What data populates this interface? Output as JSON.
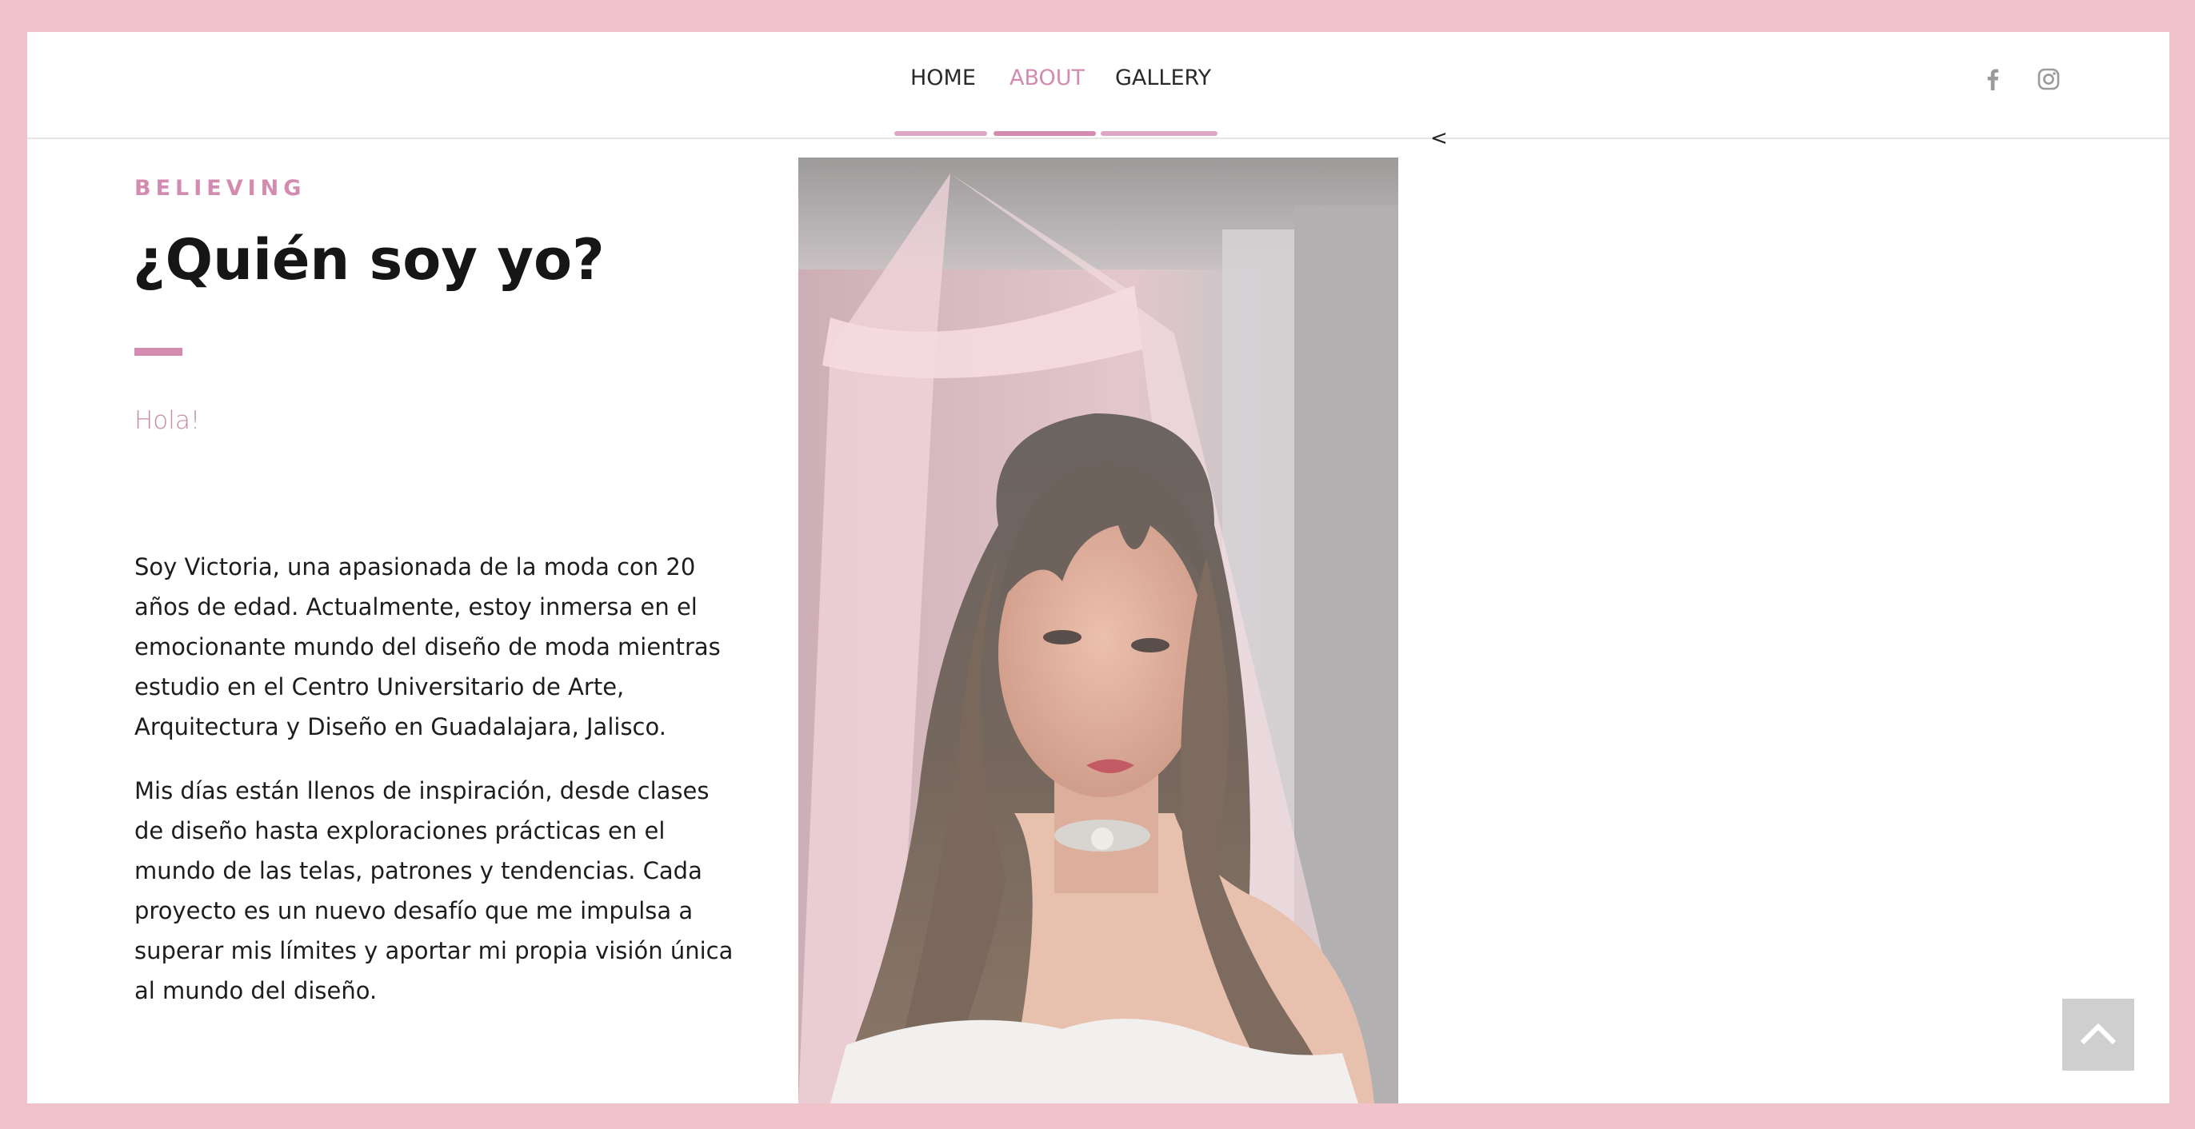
{
  "nav": {
    "items": [
      {
        "label": "HOME"
      },
      {
        "label": "ABOUT"
      },
      {
        "label": "GALLERY"
      }
    ],
    "active_index": 1,
    "social": [
      {
        "icon": "facebook-icon"
      },
      {
        "icon": "instagram-icon"
      }
    ]
  },
  "caret_text": "<",
  "about": {
    "eyebrow": "BELIEVING",
    "title": "¿Quién soy yo?",
    "greeting": "Hola!",
    "paragraphs": [
      "Soy Victoria, una apasionada de la moda con 20 años de edad. Actualmente, estoy inmersa en el emocionante mundo del diseño de moda mientras estudio en el Centro Universitario de Arte, Arquitectura y Diseño en Guadalajara, Jalisco.",
      "Mis días están llenos de inspiración, desde clases de diseño hasta exploraciones prácticas en el mundo de las telas, patrones y tendencias. Cada proyecto es un nuevo desafío que me impulsa a superar mis límites y aportar mi propia visión única al mundo del diseño."
    ]
  },
  "photo": {
    "subject": "portrait-photo"
  },
  "back_to_top": {
    "icon": "chevron-up-icon"
  },
  "colors": {
    "page_border": "#f0c3cb",
    "accent": "#d38bb0",
    "text": "#1d1d1d",
    "greeting": "#c98aa4"
  }
}
